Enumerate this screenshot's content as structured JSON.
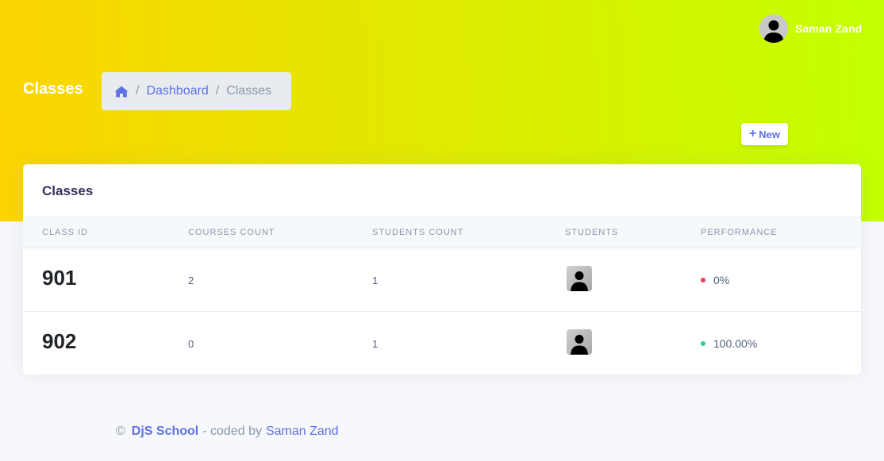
{
  "user": {
    "name": "Saman Zand"
  },
  "page": {
    "title": "Classes"
  },
  "breadcrumb": {
    "separator": "/",
    "items": [
      {
        "label": "Dashboard"
      },
      {
        "label": "Classes"
      }
    ]
  },
  "toolbar": {
    "new_label": "New",
    "new_icon": "plus-icon"
  },
  "card": {
    "title": "Classes"
  },
  "table": {
    "columns": [
      "CLASS ID",
      "COURSES COUNT",
      "STUDENTS COUNT",
      "STUDENTS",
      "PERFORMANCE"
    ],
    "rows": [
      {
        "class_id": "901",
        "courses_count": "2",
        "students_count": "1",
        "performance": "0%",
        "status_color": "#f5365c"
      },
      {
        "class_id": "902",
        "courses_count": "0",
        "students_count": "1",
        "performance": "100.00%",
        "status_color": "#2dce89"
      }
    ]
  },
  "footer": {
    "copyright": "©",
    "brand": "DjS School",
    "coded_by": "- coded by",
    "author": "Saman Zand"
  },
  "colors": {
    "accent": "#5e72e4",
    "header_gradient_start": "#fdd400",
    "header_gradient_end": "#c3ff00"
  }
}
